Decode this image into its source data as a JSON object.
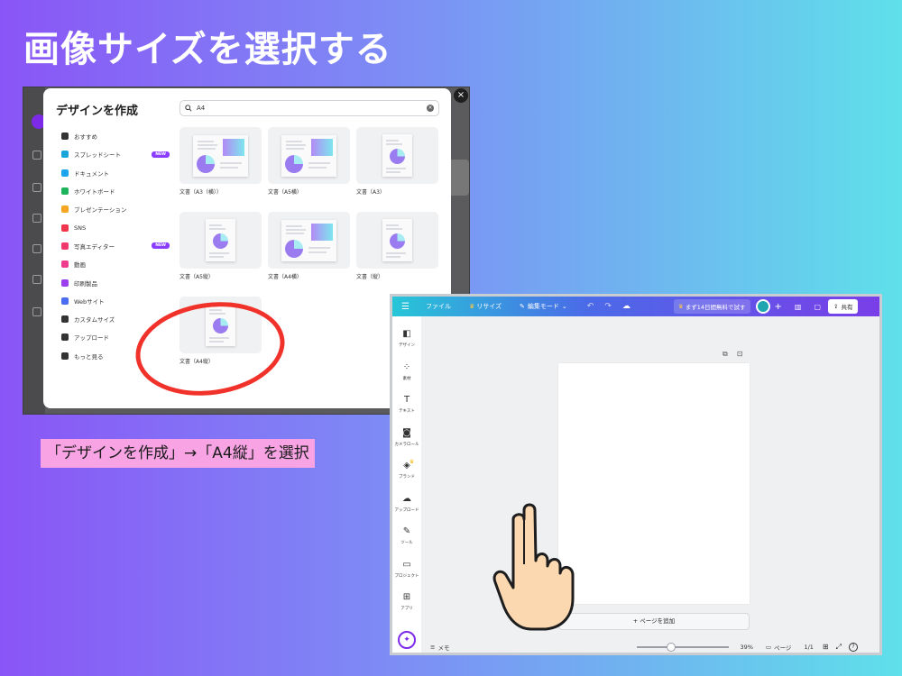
{
  "slide": {
    "title": "画像サイズを選択する",
    "caption": "「デザインを作成」→「A4縦」を選択"
  },
  "dialog": {
    "title": "デザインを作成",
    "close_icon": "×",
    "search": {
      "value": "A4",
      "clear_icon": "×"
    },
    "menu": [
      {
        "label": "おすすめ",
        "icon": "sparkle-icon",
        "color": "#333333"
      },
      {
        "label": "スプレッドシート",
        "icon": "spreadsheet-icon",
        "color": "#18a6d9",
        "badge": "NEW"
      },
      {
        "label": "ドキュメント",
        "icon": "document-icon",
        "color": "#1ea4e9"
      },
      {
        "label": "ホワイトボード",
        "icon": "whiteboard-icon",
        "color": "#1fb35b"
      },
      {
        "label": "プレゼンテーション",
        "icon": "presentation-icon",
        "color": "#f5a623"
      },
      {
        "label": "SNS",
        "icon": "sns-icon",
        "color": "#f0364a"
      },
      {
        "label": "写真エディター",
        "icon": "photo-editor-icon",
        "color": "#f03a6b",
        "badge": "NEW"
      },
      {
        "label": "動画",
        "icon": "video-icon",
        "color": "#ee3b8e"
      },
      {
        "label": "印刷製品",
        "icon": "print-icon",
        "color": "#9b3ef0"
      },
      {
        "label": "Webサイト",
        "icon": "website-icon",
        "color": "#4a6cf0"
      },
      {
        "label": "カスタムサイズ",
        "icon": "custom-size-icon",
        "color": "#333333"
      },
      {
        "label": "アップロード",
        "icon": "upload-icon",
        "color": "#333333"
      },
      {
        "label": "もっと見る",
        "icon": "more-icon",
        "color": "#333333"
      }
    ],
    "templates": [
      {
        "label": "文書（A3（横））",
        "orientation": "landscape"
      },
      {
        "label": "文書（A5横）",
        "orientation": "landscape"
      },
      {
        "label": "文書（A3）",
        "orientation": "portrait"
      },
      {
        "label": "文書（A5縦）",
        "orientation": "portrait"
      },
      {
        "label": "文書（A4横）",
        "orientation": "landscape"
      },
      {
        "label": "文書（縦）",
        "orientation": "portrait"
      },
      {
        "label": "文書（A4縦）",
        "orientation": "portrait"
      }
    ]
  },
  "editor": {
    "topbar": {
      "menu_icon": "☰",
      "file": "ファイル",
      "resize": "リサイズ",
      "edit_mode": "編集モード",
      "trial": "まず14日間無料で試す",
      "share": "共有"
    },
    "sidebar": [
      {
        "label": "デザイン",
        "icon": "design-icon",
        "glyph": "◧"
      },
      {
        "label": "素材",
        "icon": "elements-icon",
        "glyph": "⁘"
      },
      {
        "label": "テキスト",
        "icon": "text-icon",
        "glyph": "T"
      },
      {
        "label": "カメラロール",
        "icon": "camera-roll-icon",
        "glyph": "◙"
      },
      {
        "label": "ブランド",
        "icon": "brand-icon",
        "glyph": "◈"
      },
      {
        "label": "アップロード",
        "icon": "upload-icon",
        "glyph": "☁"
      },
      {
        "label": "ツール",
        "icon": "tools-icon",
        "glyph": "✎"
      },
      {
        "label": "プロジェクト",
        "icon": "projects-icon",
        "glyph": "▭"
      },
      {
        "label": "アプリ",
        "icon": "apps-icon",
        "glyph": "⊞"
      }
    ],
    "add_page": "+ ページを追加",
    "bottombar": {
      "memo": "メモ",
      "zoom": "39%",
      "pages_label": "ページ",
      "page_count": "1/1",
      "help": "?"
    },
    "zoom_level": 0.32
  },
  "colors": {
    "accent": "#7d2ae8",
    "highlight_ring": "#f0322a",
    "caption_bg": "#f7a3e4"
  }
}
